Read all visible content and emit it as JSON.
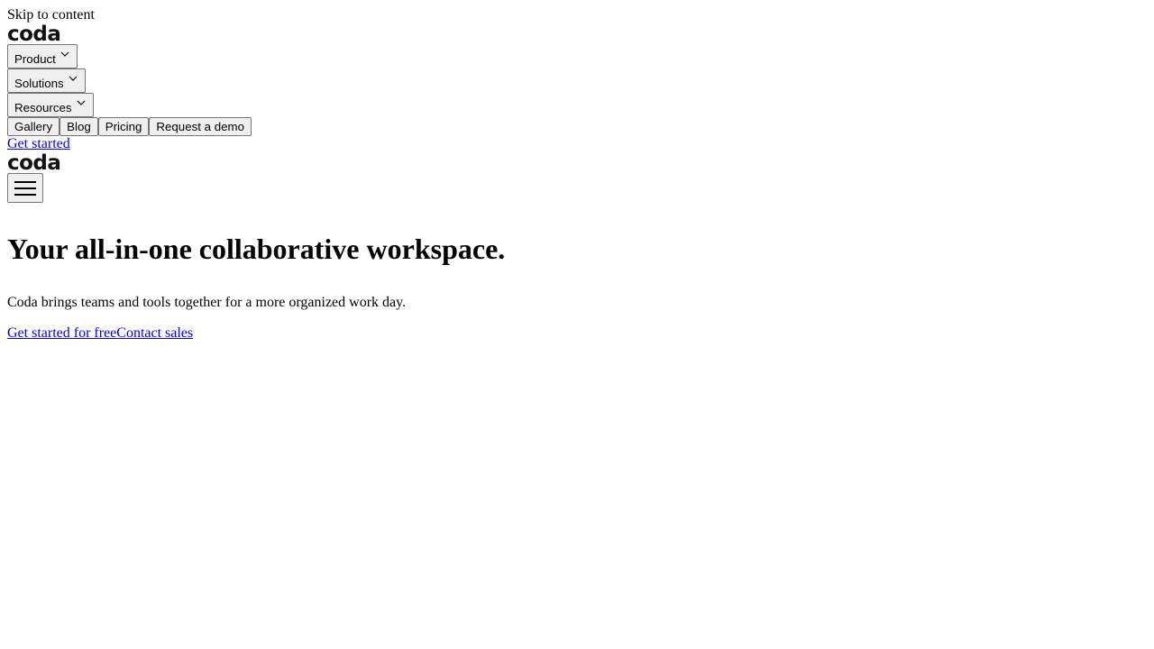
{
  "skip_link": "Skip to content",
  "brand": {
    "logo_text": "coda"
  },
  "nav": {
    "dropdowns": [
      {
        "label": "Product"
      },
      {
        "label": "Solutions"
      },
      {
        "label": "Resources"
      }
    ],
    "links": [
      {
        "label": "Gallery"
      },
      {
        "label": "Blog"
      },
      {
        "label": "Pricing"
      },
      {
        "label": "Request a demo"
      }
    ],
    "get_started": "Get started",
    "menu_icon": "hamburger-menu-icon",
    "dropdown_icon": "chevron-down-icon"
  },
  "hero": {
    "title": "Your all-in-one collaborative workspace.",
    "subtitle": "Coda brings teams and tools together for a more organized work day.",
    "cta_primary": "Get started for free",
    "cta_secondary": "Contact sales"
  },
  "colors": {
    "link": "#0000ee",
    "logo": "#121212",
    "button_bg": "#efefef",
    "button_border": "#767676"
  }
}
